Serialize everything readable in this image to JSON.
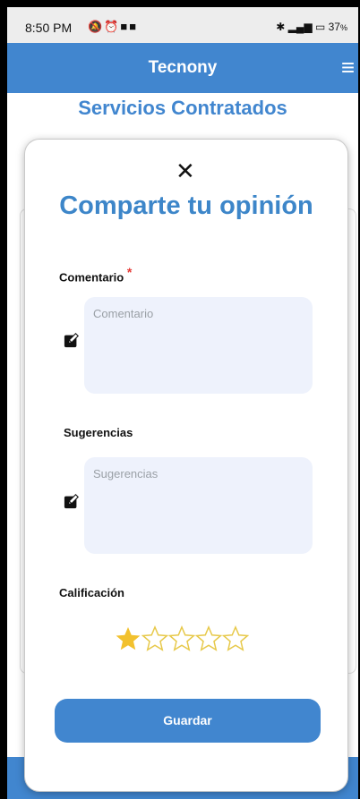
{
  "status_bar": {
    "time": "8:50 PM",
    "battery": "37"
  },
  "app_bar": {
    "title": "Tecnony"
  },
  "page": {
    "title": "Servicios Contratados"
  },
  "modal": {
    "title": "Comparte tu opinión",
    "comment": {
      "label": "Comentario",
      "required_mark": "*",
      "placeholder": "Comentario",
      "value": ""
    },
    "suggestions": {
      "label": "Sugerencias",
      "placeholder": "Sugerencias",
      "value": ""
    },
    "rating": {
      "label": "Calificación",
      "value": 1,
      "max": 5
    },
    "save_label": "Guardar"
  },
  "colors": {
    "primary": "#4186cf",
    "title_blue": "#3d86c9",
    "star_filled": "#f2c12e",
    "star_outline": "#e7c94a",
    "field_bg": "#eef2fc",
    "required": "#e53935"
  }
}
